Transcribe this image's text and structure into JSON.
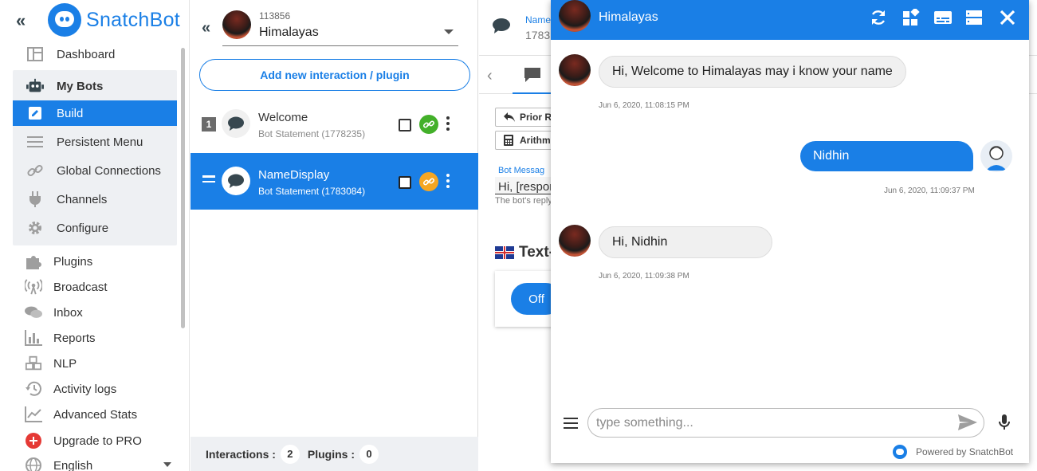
{
  "brand": {
    "name": "SnatchBot"
  },
  "sidebar": {
    "items": [
      {
        "label": "Dashboard",
        "icon": "dashboard-icon"
      },
      {
        "label": "My Bots",
        "icon": "robot-icon"
      },
      {
        "label": "Build",
        "icon": "edit-icon"
      },
      {
        "label": "Persistent Menu",
        "icon": "menu-icon"
      },
      {
        "label": "Global Connections",
        "icon": "link-icon"
      },
      {
        "label": "Channels",
        "icon": "plug-icon"
      },
      {
        "label": "Configure",
        "icon": "gear-icon"
      },
      {
        "label": "Plugins",
        "icon": "puzzle-icon"
      },
      {
        "label": "Broadcast",
        "icon": "broadcast-icon"
      },
      {
        "label": "Inbox",
        "icon": "chat-icon"
      },
      {
        "label": "Reports",
        "icon": "bar-chart-icon"
      },
      {
        "label": "NLP",
        "icon": "cubes-icon"
      },
      {
        "label": "Activity logs",
        "icon": "history-icon"
      },
      {
        "label": "Advanced Stats",
        "icon": "line-chart-icon"
      },
      {
        "label": "Upgrade to PRO",
        "icon": "plus-circle-icon"
      },
      {
        "label": "English",
        "icon": "globe-icon"
      }
    ]
  },
  "bot_selector": {
    "id": "113856",
    "name": "Himalayas"
  },
  "add_button": "Add new interaction / plugin",
  "interactions": [
    {
      "index": "1",
      "title": "Welcome",
      "subtitle": "Bot Statement (1778235)",
      "link_color": "#43b02a"
    },
    {
      "index": "=",
      "title": "NameDisplay",
      "subtitle": "Bot Statement (1783084)",
      "link_color": "#f5a623"
    }
  ],
  "footer": {
    "interactions_label": "Interactions :",
    "interactions_count": "2",
    "plugins_label": "Plugins :",
    "plugins_count": "0"
  },
  "editor": {
    "header_name": "Name",
    "header_id": "1783",
    "prior_btn": "Prior R",
    "arith_btn": "Arithm",
    "bot_message_label": "Bot Messag",
    "bot_message_value": "Hi, [respor",
    "bot_message_help": "The bot's reply",
    "tts_title": "Text-",
    "off_label": "Off"
  },
  "chat": {
    "title": "Himalayas",
    "messages": [
      {
        "from": "bot",
        "text": "Hi, Welcome to Himalayas may i know your name",
        "time": "Jun 6, 2020, 11:08:15 PM"
      },
      {
        "from": "user",
        "text": "Nidhin",
        "time": "Jun 6, 2020, 11:09:37 PM"
      },
      {
        "from": "bot",
        "text": "Hi, Nidhin",
        "time": "Jun 6, 2020, 11:09:38 PM"
      }
    ],
    "input_placeholder": "type something...",
    "powered_by": "Powered by SnatchBot"
  },
  "colors": {
    "primary": "#1a7fe6",
    "sidebar_group_bg": "#eef0f3",
    "link_green": "#43b02a",
    "link_orange": "#f5a623"
  }
}
